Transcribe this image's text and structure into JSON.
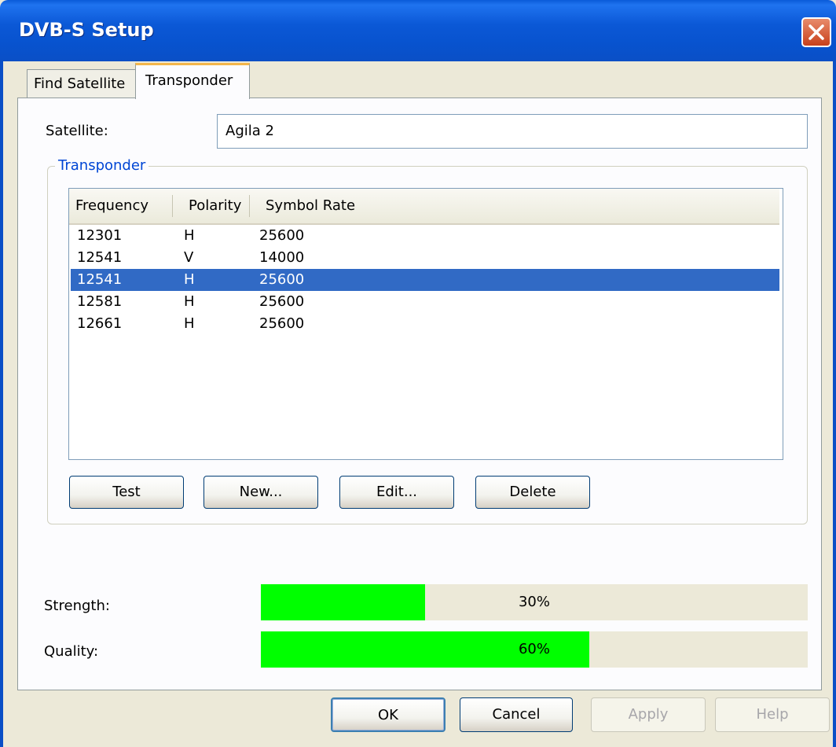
{
  "window": {
    "title": "DVB-S Setup",
    "close_icon": "close-icon",
    "colors": {
      "titlebar": "#0a5ad8",
      "close": "#c8411c"
    }
  },
  "tabs": [
    {
      "label": "Find Satellite",
      "active": false
    },
    {
      "label": "Transponder",
      "active": true
    }
  ],
  "satellite": {
    "label": "Satellite:",
    "value": "Agila 2"
  },
  "transponder_group": {
    "title": "Transponder",
    "columns": [
      "Frequency",
      "Polarity",
      "Symbol Rate"
    ],
    "rows": [
      {
        "frequency": "12301",
        "polarity": "H",
        "symbol_rate": "25600",
        "selected": false
      },
      {
        "frequency": "12541",
        "polarity": "V",
        "symbol_rate": "14000",
        "selected": false
      },
      {
        "frequency": "12541",
        "polarity": "H",
        "symbol_rate": "25600",
        "selected": true
      },
      {
        "frequency": "12581",
        "polarity": "H",
        "symbol_rate": "25600",
        "selected": false
      },
      {
        "frequency": "12661",
        "polarity": "H",
        "symbol_rate": "25600",
        "selected": false
      }
    ],
    "buttons": {
      "test": "Test",
      "new": "New...",
      "edit": "Edit...",
      "delete": "Delete"
    }
  },
  "signal": {
    "strength": {
      "label": "Strength:",
      "percent": 30,
      "text": "30%"
    },
    "quality": {
      "label": "Quality:",
      "percent": 60,
      "text": "60%"
    },
    "fill_color": "#00ff00"
  },
  "dialog_buttons": {
    "ok": "OK",
    "cancel": "Cancel",
    "apply": "Apply",
    "help": "Help"
  }
}
